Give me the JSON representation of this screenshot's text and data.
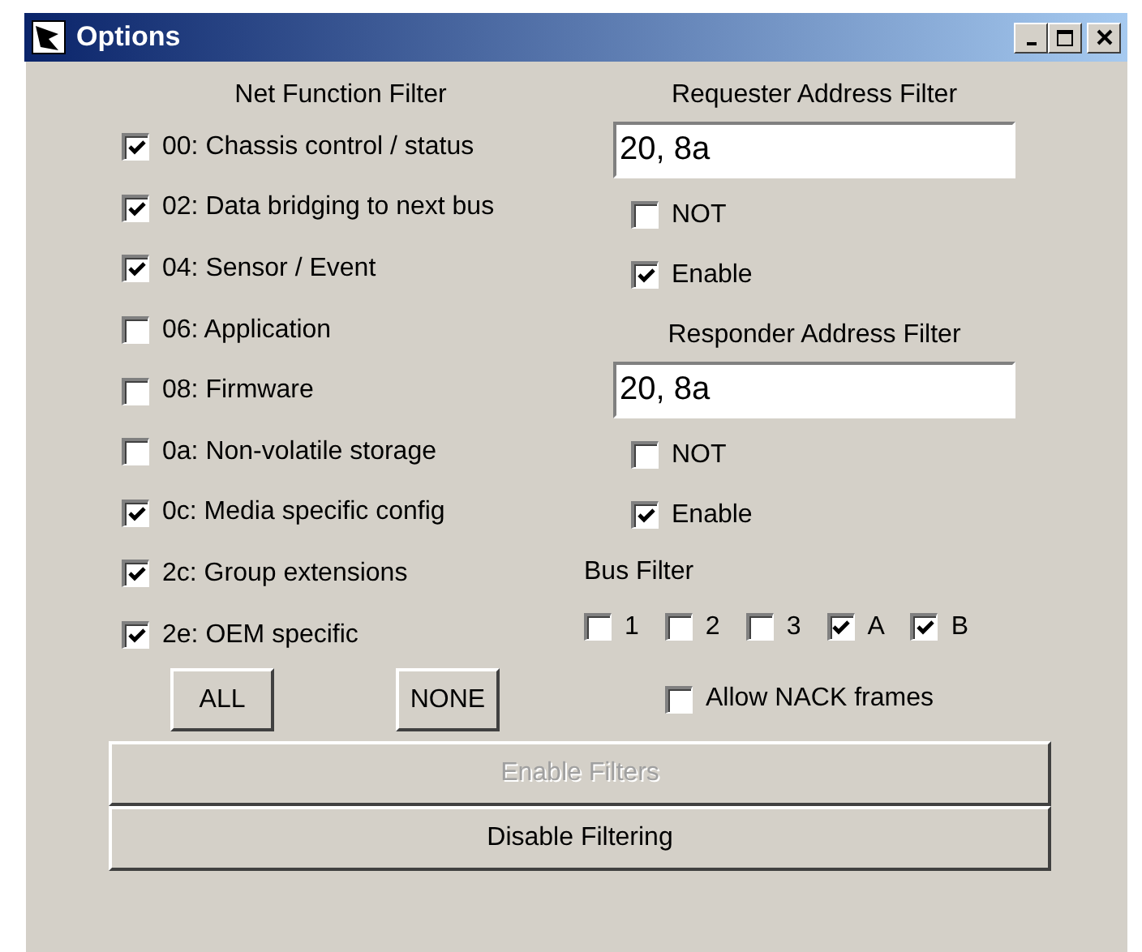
{
  "window": {
    "title": "Options"
  },
  "net_function_filter": {
    "title": "Net Function Filter",
    "items": [
      {
        "label": "00: Chassis control / status",
        "checked": true
      },
      {
        "label": "02: Data bridging to next bus",
        "checked": true
      },
      {
        "label": "04: Sensor / Event",
        "checked": true
      },
      {
        "label": "06: Application",
        "checked": false
      },
      {
        "label": "08: Firmware",
        "checked": false
      },
      {
        "label": "0a: Non-volatile storage",
        "checked": false
      },
      {
        "label": "0c: Media specific config",
        "checked": true
      },
      {
        "label": "2c: Group extensions",
        "checked": true
      },
      {
        "label": "2e: OEM specific",
        "checked": true
      }
    ],
    "buttons": [
      {
        "label": "ALL"
      },
      {
        "label": "NONE"
      }
    ]
  },
  "address_filters": [
    {
      "title": "Requester Address Filter",
      "value": "20, 8a",
      "options": [
        {
          "label": "NOT",
          "checked": false
        },
        {
          "label": "Enable",
          "checked": true
        }
      ]
    },
    {
      "title": "Responder Address Filter",
      "value": "20, 8a",
      "options": [
        {
          "label": "NOT",
          "checked": false
        },
        {
          "label": "Enable",
          "checked": true
        }
      ]
    }
  ],
  "bus_filter": {
    "title": "Bus Filter",
    "items": [
      {
        "label": "1",
        "checked": false
      },
      {
        "label": "2",
        "checked": false
      },
      {
        "label": "3",
        "checked": false
      },
      {
        "label": "A",
        "checked": true
      },
      {
        "label": "B",
        "checked": true
      }
    ]
  },
  "allow_nack": {
    "label": "Allow NACK frames",
    "checked": false
  },
  "actions": [
    {
      "label": "Enable Filters",
      "disabled": true
    },
    {
      "label": "Disable Filtering",
      "disabled": false
    }
  ]
}
